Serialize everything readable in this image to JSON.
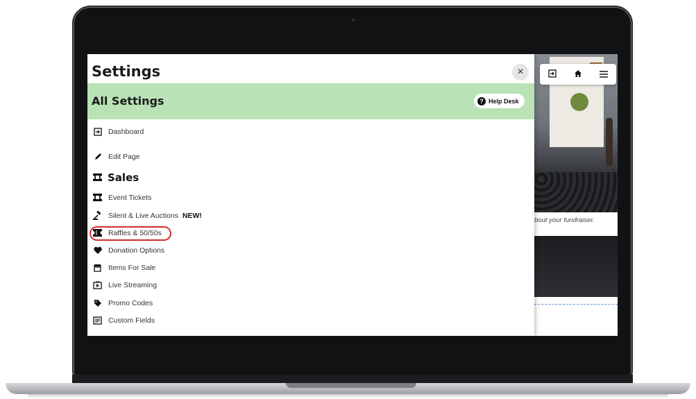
{
  "panel": {
    "title": "Settings",
    "close_label": "×",
    "all_settings_title": "All Settings",
    "help_desk_label": "Help Desk",
    "help_icon": "?"
  },
  "menu": {
    "dashboard": "Dashboard",
    "edit_page": "Edit Page",
    "sales_heading": "Sales",
    "event_tickets": "Event Tickets",
    "auctions": "Silent & Live Auctions",
    "auctions_badge": "NEW!",
    "raffles": "Raffles & 50/50s",
    "donation_options": "Donation Options",
    "items_for_sale": "Items For Sale",
    "live_streaming": "Live Streaming",
    "promo_codes": "Promo Codes",
    "custom_fields": "Custom Fields"
  },
  "background_page": {
    "tagline": "bout your fundraiser."
  },
  "icons": {
    "dashboard": "sign-in-icon",
    "edit_page": "pencil-icon",
    "sales": "ticket-icon",
    "event_tickets": "ticket-icon",
    "auctions": "gavel-icon",
    "raffles": "raffle-ticket-icon",
    "donation": "heart-icon",
    "items": "store-icon",
    "streaming": "video-icon",
    "promo": "tag-icon",
    "custom": "form-icon",
    "toolbar": [
      "sign-in-icon",
      "home-icon",
      "menu-icon"
    ]
  },
  "colors": {
    "all_settings_bar": "#b9e2b7",
    "highlight_ring": "#d12b2b",
    "panel_bg": "#ffffff"
  }
}
